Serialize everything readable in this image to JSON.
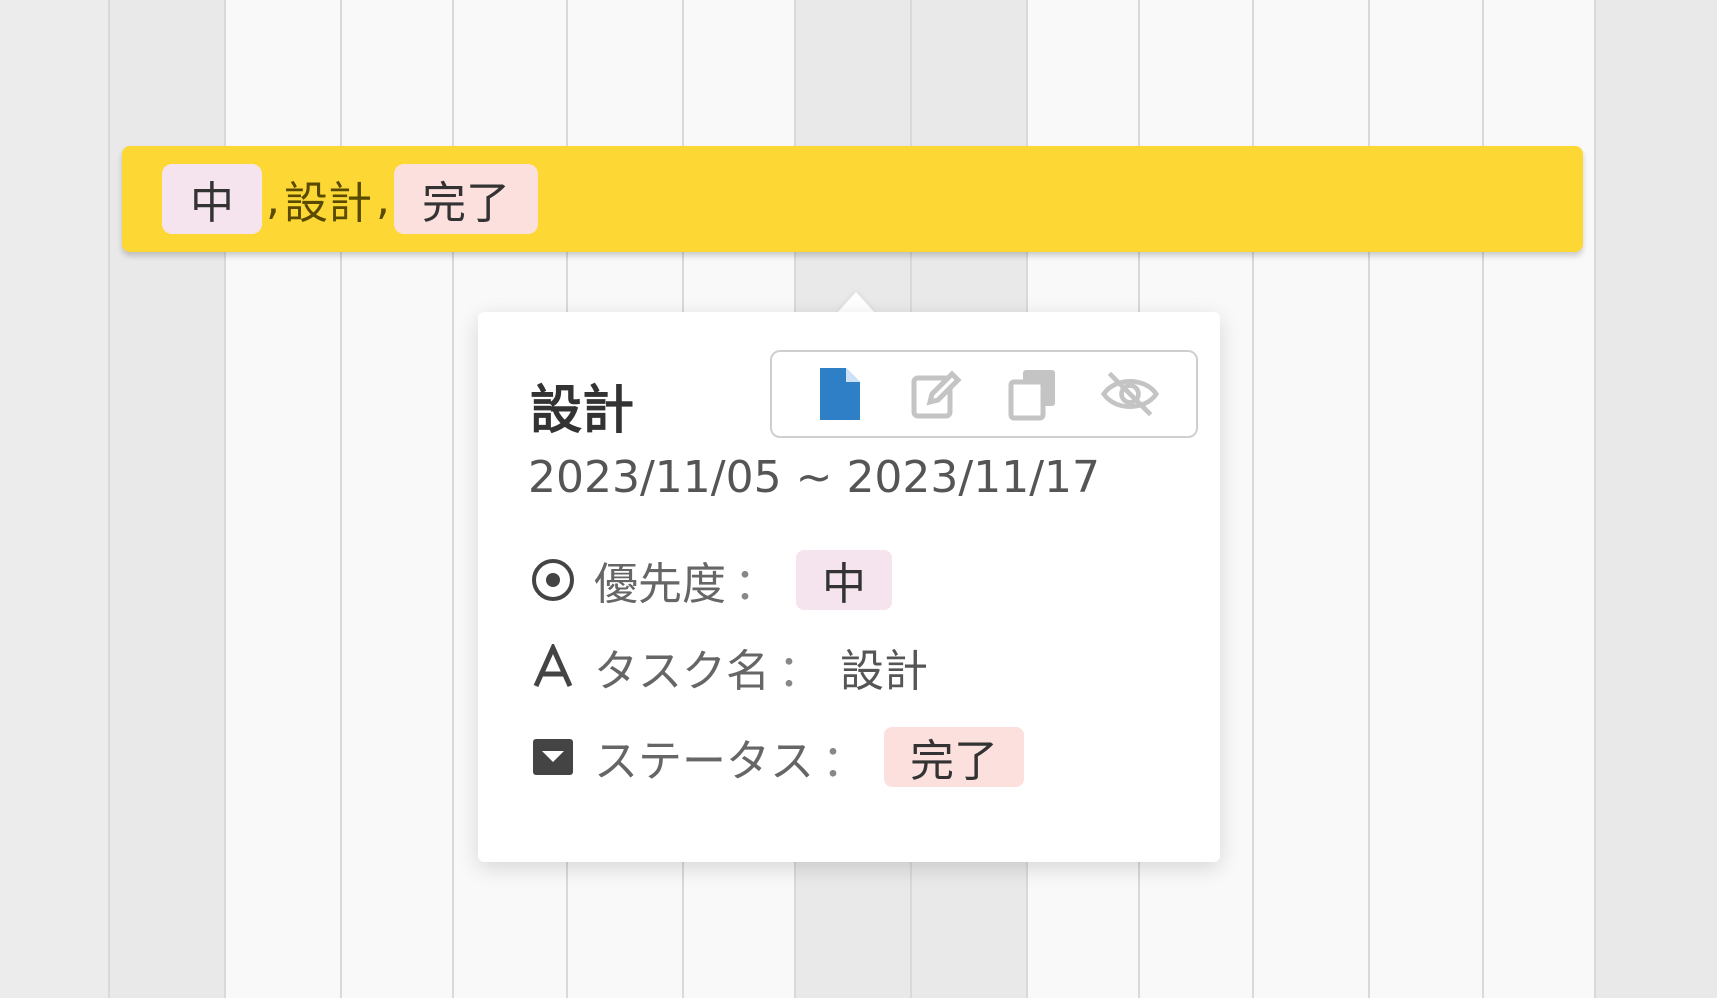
{
  "task_bar": {
    "priority_tag": "中",
    "separator": ",",
    "task_name": "設計",
    "status_tag": "完了",
    "color": "#fdd835"
  },
  "popover": {
    "title": "設計",
    "date_range": "2023/11/05 ~ 2023/11/17",
    "toolbar": {
      "icons": [
        "document-icon",
        "edit-icon",
        "duplicate-icon",
        "hide-icon"
      ],
      "accent_color": "#2f7fc7"
    },
    "properties": [
      {
        "label": "優先度",
        "colon": "：",
        "value": "中",
        "kind": "tag-priority",
        "icon": "target-icon"
      },
      {
        "label": "タスク名",
        "colon": "：",
        "value": "設計",
        "kind": "text",
        "icon": "text-icon"
      },
      {
        "label": "ステータス",
        "colon": "：",
        "value": "完了",
        "kind": "tag-status",
        "icon": "select-icon"
      }
    ]
  },
  "colors": {
    "priority_tag_bg": "#f5e4ee",
    "status_tag_bg": "#fbe0de",
    "weekend_col_bg": "#e9e9e9",
    "weekday_col_bg": "#f9f9f9"
  }
}
